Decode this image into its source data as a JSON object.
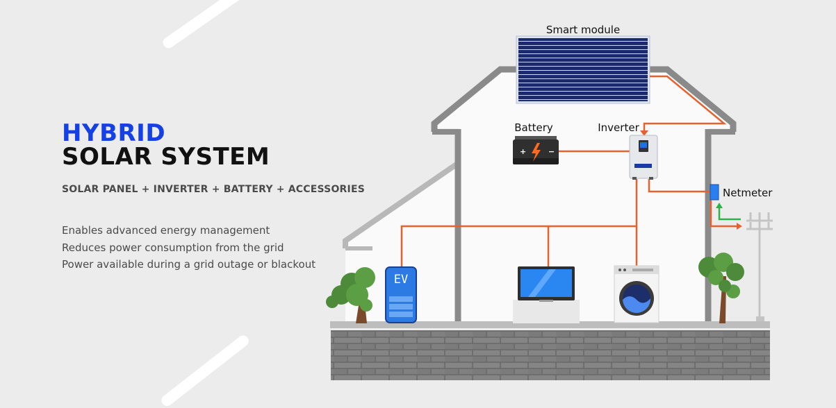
{
  "heading": {
    "line1": "HYBRID",
    "line2": "SOLAR SYSTEM",
    "line1_color": "#1440e6",
    "line2_color": "#111111"
  },
  "subtitle": "SOLAR PANEL + INVERTER + BATTERY + ACCESSORIES",
  "features": [
    "Enables advanced energy management",
    "Reduces power consumption from the grid",
    "Power available during a grid outage or blackout"
  ],
  "diagram": {
    "labels": {
      "smart_module": "Smart module",
      "battery": "Battery",
      "inverter": "Inverter",
      "netmeter": "Netmeter",
      "ev": "EV"
    },
    "colors": {
      "wire": "#e8602c",
      "grid_in": "#2bb34a",
      "house_outline": "#8a8a8a",
      "panel": "#1c2a6e",
      "netmeter": "#2a7ff0"
    }
  }
}
